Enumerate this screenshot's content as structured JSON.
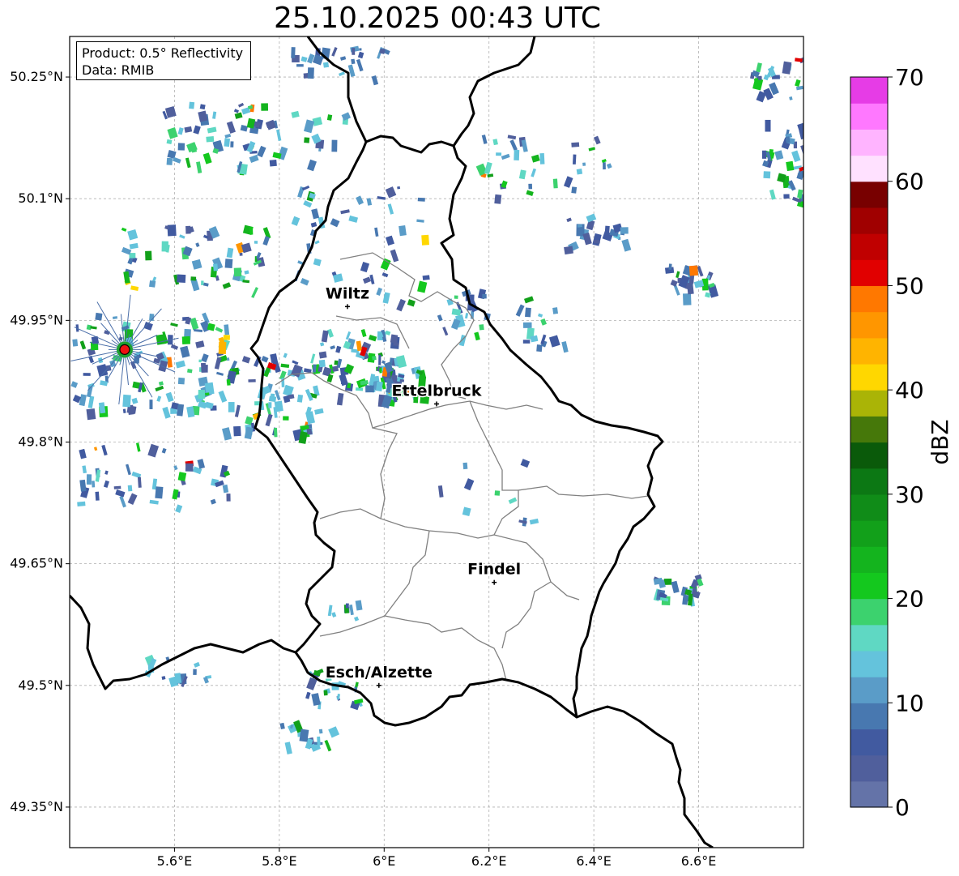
{
  "title": "25.10.2025 00:43 UTC",
  "info": {
    "product": "Product: 0.5° Reflectivity",
    "data": "Data: RMIB"
  },
  "axes": {
    "lon_min": 5.4,
    "lon_max": 6.8,
    "lat_min": 49.3,
    "lat_max": 50.3,
    "x_ticks": [
      {
        "value": 5.6,
        "label": "5.6°E"
      },
      {
        "value": 5.8,
        "label": "5.8°E"
      },
      {
        "value": 6.0,
        "label": "6°E"
      },
      {
        "value": 6.2,
        "label": "6.2°E"
      },
      {
        "value": 6.4,
        "label": "6.4°E"
      },
      {
        "value": 6.6,
        "label": "6.6°E"
      }
    ],
    "y_ticks": [
      {
        "value": 50.25,
        "label": "50.25°N"
      },
      {
        "value": 50.1,
        "label": "50.1°N"
      },
      {
        "value": 49.95,
        "label": "49.95°N"
      },
      {
        "value": 49.8,
        "label": "49.8°N"
      },
      {
        "value": 49.65,
        "label": "49.65°N"
      },
      {
        "value": 49.5,
        "label": "49.5°N"
      },
      {
        "value": 49.35,
        "label": "49.35°N"
      }
    ],
    "grid": true
  },
  "cities": [
    {
      "name": "Wiltz",
      "lon": 5.93,
      "lat": 49.967
    },
    {
      "name": "Ettelbruck",
      "lon": 6.1,
      "lat": 49.847
    },
    {
      "name": "Findel",
      "lon": 6.21,
      "lat": 49.627
    },
    {
      "name": "Esch/Alzette",
      "lon": 5.99,
      "lat": 49.5
    }
  ],
  "radar_site": {
    "lon": 5.505,
    "lat": 49.914,
    "color": "#ee1111"
  },
  "colorbar": {
    "label": "dBZ",
    "min": 0,
    "max": 70,
    "ticks": [
      {
        "value": 70,
        "label": "70"
      },
      {
        "value": 60,
        "label": "60"
      },
      {
        "value": 50,
        "label": "50"
      },
      {
        "value": 40,
        "label": "40"
      },
      {
        "value": 30,
        "label": "30"
      },
      {
        "value": 20,
        "label": "20"
      },
      {
        "value": 10,
        "label": "10"
      },
      {
        "value": 0,
        "label": "0"
      }
    ],
    "colors": [
      "#6473a8",
      "#505f9c",
      "#415aa0",
      "#4878b0",
      "#5a9cc8",
      "#64c3dc",
      "#5fd8c3",
      "#3cd26e",
      "#14c81e",
      "#14b41e",
      "#12a01a",
      "#108c18",
      "#0c7814",
      "#0a5a0a",
      "#46780a",
      "#aab406",
      "#ffd700",
      "#ffb400",
      "#ff9600",
      "#ff7800",
      "#e10000",
      "#c00000",
      "#a00000",
      "#780000",
      "#ffe1ff",
      "#ffb4ff",
      "#ff78ff",
      "#e63ce6"
    ]
  },
  "radar_clusters": [
    {
      "lon": 5.75,
      "lat": 50.18,
      "w": 0.35,
      "h": 0.08,
      "n": 70,
      "i": 0.3
    },
    {
      "lon": 5.9,
      "lat": 50.27,
      "w": 0.2,
      "h": 0.04,
      "n": 25,
      "i": 0.15
    },
    {
      "lon": 5.65,
      "lat": 50.03,
      "w": 0.3,
      "h": 0.08,
      "n": 60,
      "i": 0.4
    },
    {
      "lon": 5.55,
      "lat": 49.9,
      "w": 0.3,
      "h": 0.12,
      "n": 110,
      "i": 0.35
    },
    {
      "lon": 5.78,
      "lat": 49.86,
      "w": 0.18,
      "h": 0.1,
      "n": 70,
      "i": 0.4
    },
    {
      "lon": 5.95,
      "lat": 49.9,
      "w": 0.15,
      "h": 0.08,
      "n": 60,
      "i": 0.35
    },
    {
      "lon": 6.02,
      "lat": 49.88,
      "w": 0.1,
      "h": 0.05,
      "n": 40,
      "i": 0.45
    },
    {
      "lon": 5.55,
      "lat": 49.76,
      "w": 0.3,
      "h": 0.08,
      "n": 45,
      "i": 0.15
    },
    {
      "lon": 5.95,
      "lat": 50.05,
      "w": 0.25,
      "h": 0.15,
      "n": 45,
      "i": 0.3
    },
    {
      "lon": 6.3,
      "lat": 50.14,
      "w": 0.25,
      "h": 0.08,
      "n": 35,
      "i": 0.3
    },
    {
      "lon": 6.4,
      "lat": 50.06,
      "w": 0.12,
      "h": 0.04,
      "n": 20,
      "i": 0.1
    },
    {
      "lon": 6.58,
      "lat": 50.0,
      "w": 0.1,
      "h": 0.04,
      "n": 28,
      "i": 0.15
    },
    {
      "lon": 6.77,
      "lat": 50.15,
      "w": 0.1,
      "h": 0.1,
      "n": 45,
      "i": 0.3
    },
    {
      "lon": 6.75,
      "lat": 50.25,
      "w": 0.1,
      "h": 0.05,
      "n": 20,
      "i": 0.1
    },
    {
      "lon": 6.3,
      "lat": 49.95,
      "w": 0.08,
      "h": 0.06,
      "n": 15,
      "i": 0.3
    },
    {
      "lon": 6.15,
      "lat": 49.96,
      "w": 0.1,
      "h": 0.06,
      "n": 20,
      "i": 0.3
    },
    {
      "lon": 6.55,
      "lat": 49.62,
      "w": 0.1,
      "h": 0.03,
      "n": 25,
      "i": 0.25
    },
    {
      "lon": 5.9,
      "lat": 49.5,
      "w": 0.1,
      "h": 0.04,
      "n": 20,
      "i": 0.3
    },
    {
      "lon": 5.85,
      "lat": 49.44,
      "w": 0.1,
      "h": 0.03,
      "n": 15,
      "i": 0.25
    },
    {
      "lon": 5.6,
      "lat": 49.52,
      "w": 0.12,
      "h": 0.03,
      "n": 15,
      "i": 0.35
    },
    {
      "lon": 6.2,
      "lat": 49.74,
      "w": 0.2,
      "h": 0.08,
      "n": 10,
      "i": 0.15
    },
    {
      "lon": 5.92,
      "lat": 49.59,
      "w": 0.06,
      "h": 0.03,
      "n": 8,
      "i": 0.3
    }
  ]
}
